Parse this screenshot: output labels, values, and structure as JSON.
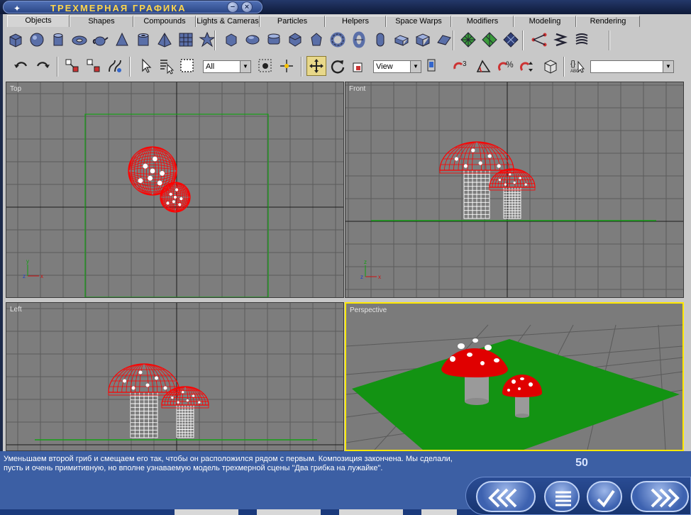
{
  "window": {
    "title": "ТРЕХМЕРНАЯ ГРАФИКА",
    "minimize_symbol": "−",
    "close_symbol": "×"
  },
  "tabs": [
    {
      "label": "Objects",
      "active": true
    },
    {
      "label": "Shapes",
      "active": false
    },
    {
      "label": "Compounds",
      "active": false
    },
    {
      "label": "Lights & Cameras",
      "active": false
    },
    {
      "label": "Particles",
      "active": false
    },
    {
      "label": "Helpers",
      "active": false
    },
    {
      "label": "Space Warps",
      "active": false
    },
    {
      "label": "Modifiers",
      "active": false
    },
    {
      "label": "Modeling",
      "active": false
    },
    {
      "label": "Rendering",
      "active": false
    }
  ],
  "toolbar_objects": [
    "box-icon",
    "sphere-icon",
    "cylinder-icon",
    "torus-icon",
    "teapot-icon",
    "cone-icon",
    "tube-icon",
    "pyramid-icon",
    "plane-grid-icon",
    "star-icon",
    "chamfer-box-icon",
    "capsule-icon",
    "oil-tank-icon",
    "gengon-icon",
    "spindle-icon",
    "torus-knot-icon",
    "ring-wave-icon",
    "capsule2-icon",
    "l-extrusion-icon",
    "c-extrusion-icon",
    "prism-icon",
    "patch-grid-icon",
    "tri-patch-icon",
    "diamond-icon",
    "path-icon",
    "spring-icon",
    "hose-icon"
  ],
  "toolbar_main": {
    "selection_filter": "All",
    "reference_coord": "View",
    "named_selection": ""
  },
  "viewports": [
    {
      "id": "top",
      "label": "Top",
      "active": false
    },
    {
      "id": "front",
      "label": "Front",
      "active": false
    },
    {
      "id": "left",
      "label": "Left",
      "active": false
    },
    {
      "id": "perspective",
      "label": "Perspective",
      "active": true
    }
  ],
  "axis_labels": {
    "x": "x",
    "y": "y",
    "z": "z"
  },
  "colors": {
    "wireframe": "#ff0000",
    "ground": "#1a9a1a",
    "active_border": "#ffe800",
    "grid_bg": "#7d7d7d",
    "grid_line": "#5a5a5a"
  },
  "caption": {
    "text": "Уменьшаем второй гриб и смещаем его так, чтобы он расположился рядом с первым. Композиция закончена. Мы сделали, пусть и очень примитивную, но вполне узнаваемую модель трехмерной сцены \"Два грибка на лужайке\".",
    "page_number": "50"
  },
  "nav": [
    {
      "name": "rewind-button",
      "icon": "double-chevron-left-icon"
    },
    {
      "name": "contents-button",
      "icon": "menu-lines-icon"
    },
    {
      "name": "check-button",
      "icon": "checkmark-icon"
    },
    {
      "name": "forward-button",
      "icon": "double-chevron-right-icon"
    }
  ]
}
